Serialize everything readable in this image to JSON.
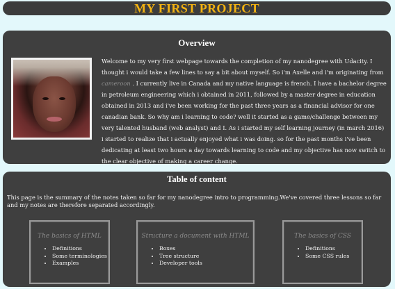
{
  "header": {
    "title": "MY FIRST PROJECT"
  },
  "overview": {
    "heading": "Overview",
    "bio_before_link": "Welcome to my very first webpage towards the completion of my nanodegree with Udacity. I thought i would take a few lines to say a bit about myself. So i'm Axelle and i'm originating from ",
    "link_text": "cameroon",
    "bio_after_link": " . I currently live in Canada and my native language is french. I have a bachelor degree in petroleum engineering which i obtained in 2011, followed by a master degree in education obtained in 2013 and i've been working for the past three years as a financial advisor for one canadian bank. So why am i learning to code? well it started as a game/challenge between my very talented husband (web analyst) and I. As i started my self learning journey (in march 2016) i started to realize that i actually enjoyed what i was doing. so for the past months i've been dedicating at least two hours a day towards learning to code and my objective has now switch to the clear objective of making a career change."
  },
  "toc": {
    "heading": "Table of content",
    "intro": "This page is the summary of the notes taken so far for my nanodegree intro to programming.We've covered three lessons so far and my notes are therefore separated accordingly.",
    "cards": [
      {
        "title": "The basics of HTML",
        "items": [
          "Definitions",
          "Some terminologies",
          "Examples"
        ]
      },
      {
        "title": "Structure a document with HTML",
        "items": [
          "Boxes",
          "Tree structure",
          "Developer tools"
        ]
      },
      {
        "title": "The basics of CSS",
        "items": [
          "Definitions",
          "Some CSS rules"
        ]
      }
    ]
  }
}
